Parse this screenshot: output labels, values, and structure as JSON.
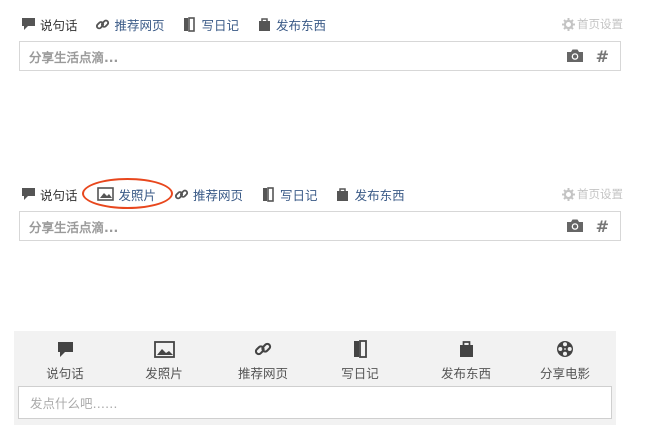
{
  "composer1": {
    "tabs": [
      {
        "label": "说句话",
        "icon": "speech-bubble-icon"
      },
      {
        "label": "推荐网页",
        "icon": "link-icon"
      },
      {
        "label": "写日记",
        "icon": "book-icon"
      },
      {
        "label": "发布东西",
        "icon": "bag-icon"
      }
    ],
    "settings_label": "首页设置",
    "placeholder": "分享生活点滴...",
    "hash_label": "#"
  },
  "composer2": {
    "tabs": [
      {
        "label": "说句话",
        "icon": "speech-bubble-icon"
      },
      {
        "label": "发照片",
        "icon": "image-icon"
      },
      {
        "label": "推荐网页",
        "icon": "link-icon"
      },
      {
        "label": "写日记",
        "icon": "book-icon"
      },
      {
        "label": "发布东西",
        "icon": "bag-icon"
      }
    ],
    "settings_label": "首页设置",
    "placeholder": "分享生活点滴...",
    "hash_label": "#",
    "highlight_color": "#e8471d"
  },
  "composer3": {
    "tabs": [
      {
        "label": "说句话",
        "icon": "speech-bubble-icon"
      },
      {
        "label": "发照片",
        "icon": "image-icon"
      },
      {
        "label": "推荐网页",
        "icon": "link-icon"
      },
      {
        "label": "写日记",
        "icon": "book-icon"
      },
      {
        "label": "发布东西",
        "icon": "bag-icon"
      },
      {
        "label": "分享电影",
        "icon": "film-reel-icon"
      }
    ],
    "placeholder": "发点什么吧……"
  },
  "colors": {
    "link": "#3a5a87",
    "icon": "#555555",
    "settings": "#c4c4c4",
    "panel_bg": "#f2f2f2"
  }
}
